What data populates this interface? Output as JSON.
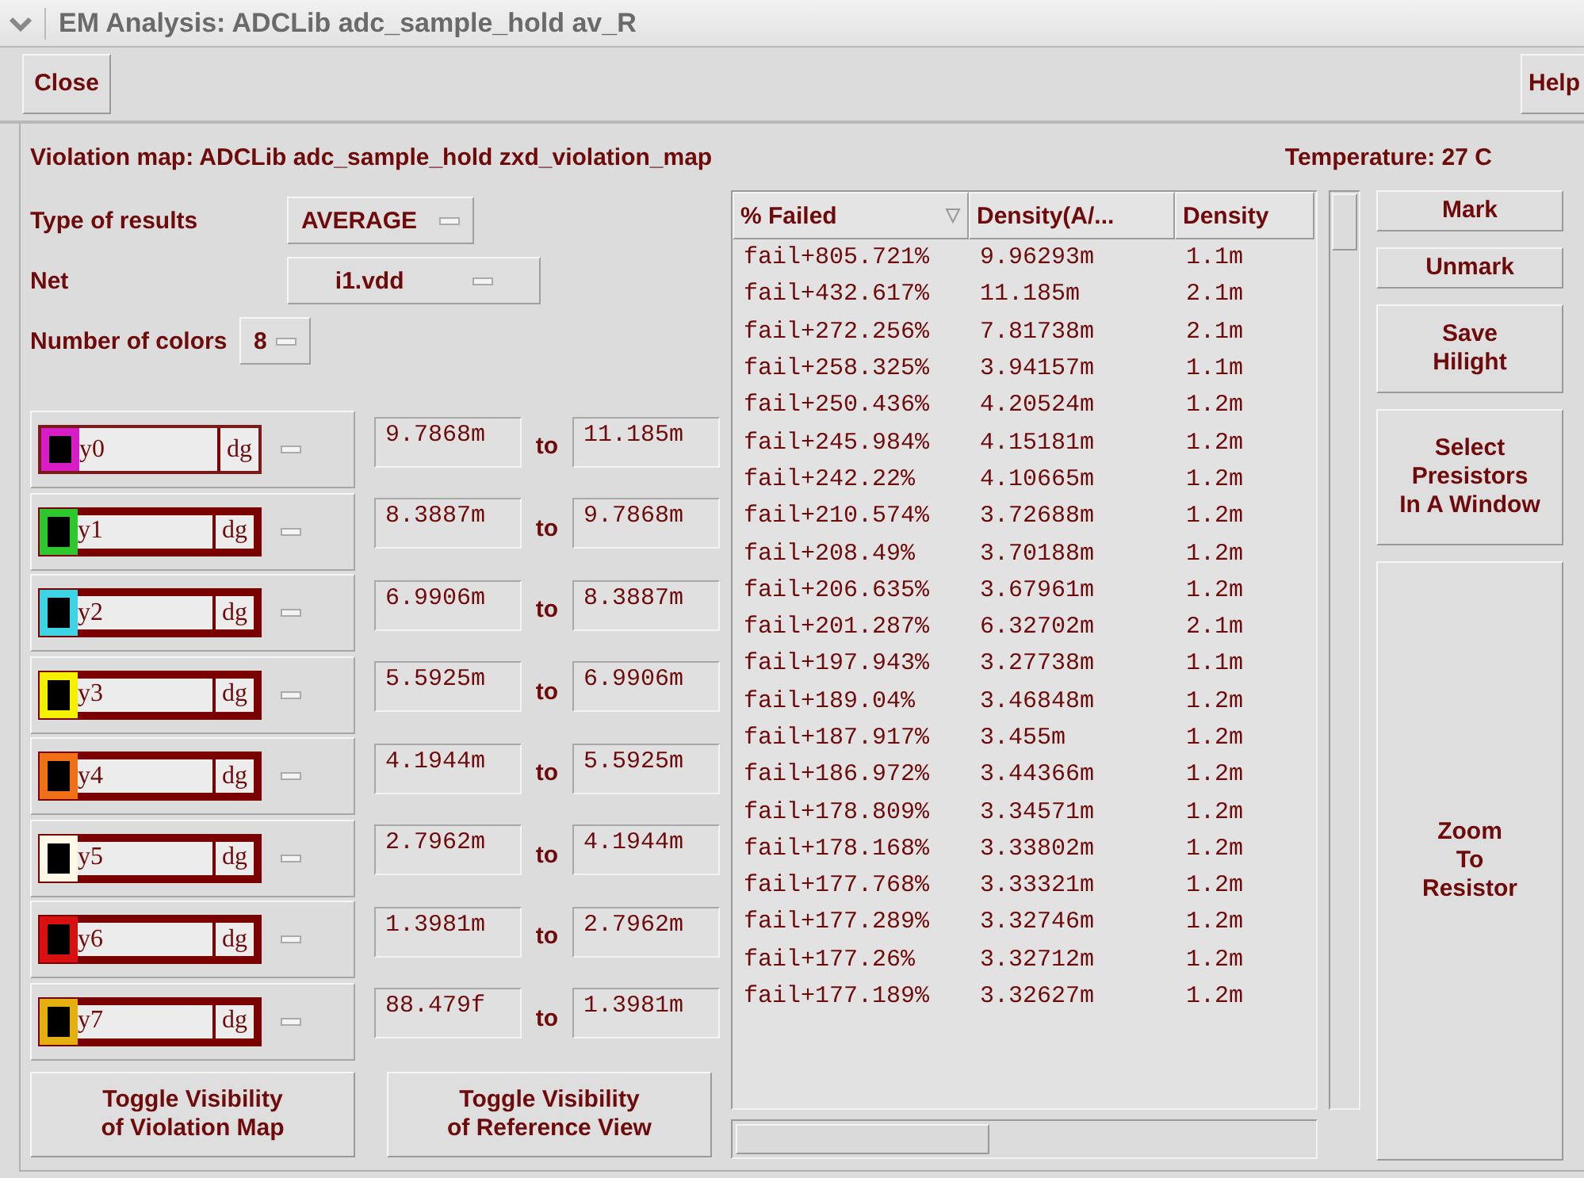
{
  "window": {
    "title": "EM Analysis: ADCLib adc_sample_hold av_R"
  },
  "toolbar": {
    "left_button": "Close",
    "right_button": "Help"
  },
  "info": {
    "violation_map": "Violation map: ADCLib adc_sample_hold zxd_violation_map",
    "temperature": "Temperature: 27 C"
  },
  "form": [
    {
      "label": "Type of results",
      "value": "AVERAGE",
      "kind": "compact"
    },
    {
      "label": "Net",
      "value": "i1.vdd",
      "kind": "wide"
    },
    {
      "label": "Number of colors",
      "value": "8",
      "kind": "inline"
    }
  ],
  "layers": [
    {
      "name": "y0",
      "purpose": "dg",
      "color": "#d81cc8",
      "selected": true,
      "from": "9.7868m",
      "joiner": "to",
      "to": "11.185m"
    },
    {
      "name": "y1",
      "purpose": "dg",
      "color": "#2ec82e",
      "selected": false,
      "from": "8.3887m",
      "joiner": "to",
      "to": "9.7868m"
    },
    {
      "name": "y2",
      "purpose": "dg",
      "color": "#3cd4e4",
      "selected": false,
      "from": "6.9906m",
      "joiner": "to",
      "to": "8.3887m"
    },
    {
      "name": "y3",
      "purpose": "dg",
      "color": "#f4f000",
      "selected": false,
      "from": "5.5925m",
      "joiner": "to",
      "to": "6.9906m"
    },
    {
      "name": "y4",
      "purpose": "dg",
      "color": "#f07018",
      "selected": false,
      "from": "4.1944m",
      "joiner": "to",
      "to": "5.5925m"
    },
    {
      "name": "y5",
      "purpose": "dg",
      "color": "#fff8e6",
      "selected": false,
      "from": "2.7962m",
      "joiner": "to",
      "to": "4.1944m"
    },
    {
      "name": "y6",
      "purpose": "dg",
      "color": "#d81010",
      "selected": false,
      "from": "1.3981m",
      "joiner": "to",
      "to": "2.7962m"
    },
    {
      "name": "y7",
      "purpose": "dg",
      "color": "#e4b010",
      "selected": false,
      "from": "88.479f",
      "joiner": "to",
      "to": "1.3981m"
    }
  ],
  "bottom_buttons": [
    {
      "line1": "Toggle Visibility",
      "line2": "of Violation Map"
    },
    {
      "line1": "Toggle Visibility",
      "line2": "of Reference View"
    }
  ],
  "table": {
    "columns": [
      "% Failed",
      "Density(A/...",
      "Density"
    ],
    "rows": [
      [
        "fail+805.721%",
        "9.96293m",
        "1.1m"
      ],
      [
        "fail+432.617%",
        "11.185m",
        "2.1m"
      ],
      [
        "fail+272.256%",
        "7.81738m",
        "2.1m"
      ],
      [
        "fail+258.325%",
        "3.94157m",
        "1.1m"
      ],
      [
        "fail+250.436%",
        "4.20524m",
        "1.2m"
      ],
      [
        "fail+245.984%",
        "4.15181m",
        "1.2m"
      ],
      [
        "fail+242.22%",
        "4.10665m",
        "1.2m"
      ],
      [
        "fail+210.574%",
        "3.72688m",
        "1.2m"
      ],
      [
        "fail+208.49%",
        "3.70188m",
        "1.2m"
      ],
      [
        "fail+206.635%",
        "3.67961m",
        "1.2m"
      ],
      [
        "fail+201.287%",
        "6.32702m",
        "2.1m"
      ],
      [
        "fail+197.943%",
        "3.27738m",
        "1.1m"
      ],
      [
        "fail+189.04%",
        "3.46848m",
        "1.2m"
      ],
      [
        "fail+187.917%",
        "3.455m",
        "1.2m"
      ],
      [
        "fail+186.972%",
        "3.44366m",
        "1.2m"
      ],
      [
        "fail+178.809%",
        "3.34571m",
        "1.2m"
      ],
      [
        "fail+178.168%",
        "3.33802m",
        "1.2m"
      ],
      [
        "fail+177.768%",
        "3.33321m",
        "1.2m"
      ],
      [
        "fail+177.289%",
        "3.32746m",
        "1.2m"
      ],
      [
        "fail+177.26%",
        "3.32712m",
        "1.2m"
      ],
      [
        "fail+177.189%",
        "3.32627m",
        "1.2m"
      ]
    ]
  },
  "side_buttons": [
    {
      "lines": [
        "Mark"
      ],
      "kind": "small"
    },
    {
      "lines": [
        "Unmark"
      ],
      "kind": "small"
    },
    {
      "lines": [
        "Save",
        "Hilight"
      ],
      "kind": "medium"
    },
    {
      "lines": [
        "Select",
        "Presistors",
        "In A Window"
      ],
      "kind": "medium"
    },
    {
      "lines": [
        "Zoom",
        "To",
        "Resistor"
      ],
      "kind": "fill"
    }
  ]
}
